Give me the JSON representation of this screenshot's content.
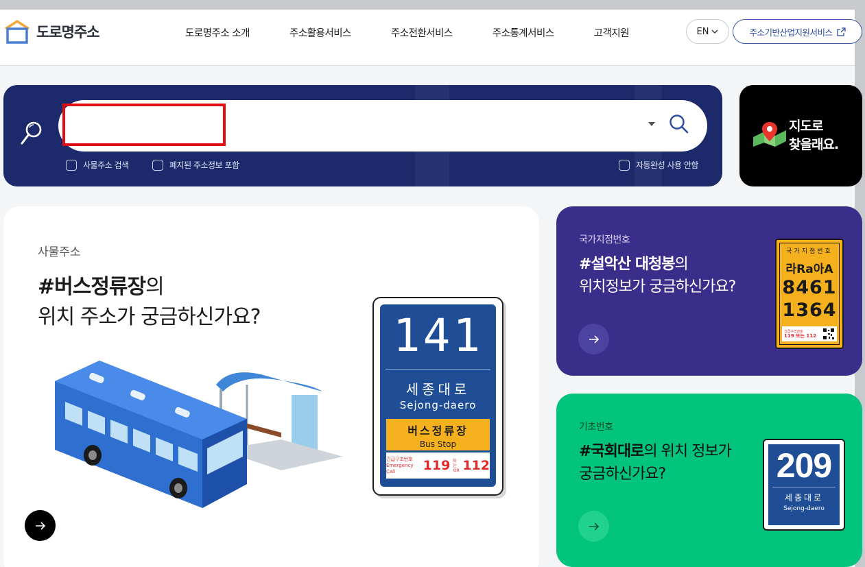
{
  "header": {
    "logo_text": "도로명주소",
    "nav": [
      "도로명주소 소개",
      "주소활용서비스",
      "주소전환서비스",
      "주소통계서비스",
      "고객지원"
    ],
    "lang": "EN",
    "external_button": "주소기반산업지원서비스"
  },
  "search": {
    "value": "",
    "options": {
      "object_address": "사물주소 검색",
      "include_abolished": "폐지된 주소정보 포함",
      "autocomplete_off": "자동완성 사용 안함"
    }
  },
  "map_card": {
    "line1": "지도로",
    "line2": "찾을래요."
  },
  "main_card": {
    "tag": "사물주소",
    "title_bold": "#버스정류장",
    "title_rest1": "의",
    "title_line2": "위치 주소가 궁금하신가요?",
    "sign": {
      "number": "141",
      "road_ko": "세종대로",
      "road_en": "Sejong-daero",
      "stop_ko": "버스정류장",
      "stop_en": "Bus Stop",
      "emergency_ko": "긴급구조번호",
      "emergency_en": "Emergency Call",
      "num1": "119",
      "or": "또는",
      "or_en": "OR",
      "num2": "112"
    }
  },
  "purple_card": {
    "tag": "국가지점번호",
    "title_bold": "#설악산 대청봉",
    "title_rest1": "의",
    "title_line2": "위치정보가 궁금하신가요?",
    "plate": {
      "header": "국가지점번호",
      "row1": "라Ra아A",
      "row2": "8461",
      "row3": "1364",
      "footer_small": "긴급구조번호",
      "footer_num": "119 또는 112"
    }
  },
  "green_card": {
    "tag": "기초번호",
    "title_bold": "#국회대로",
    "title_rest1": "의 위치 정보가",
    "title_line2": "궁금하신가요?",
    "sign": {
      "number": "209",
      "road_ko": "세종대로",
      "road_en": "Sejong-daero"
    }
  },
  "colors": {
    "navy": "#1c2a6b",
    "purple": "#3a2e8a",
    "green": "#02c47c",
    "sign_blue": "#1f4e97",
    "sign_yellow": "#f5b11d",
    "highlight_red": "#e20e13"
  }
}
